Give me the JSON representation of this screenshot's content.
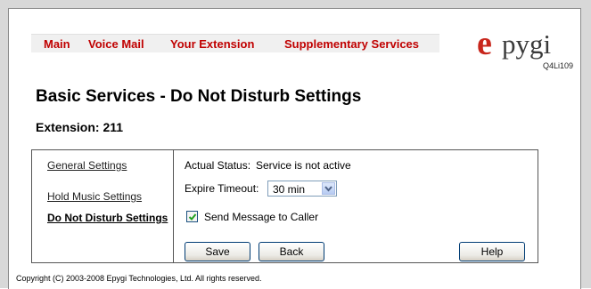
{
  "nav": {
    "items": [
      {
        "label": "Main"
      },
      {
        "label": "Voice Mail"
      },
      {
        "label": "Your Extension"
      },
      {
        "label": "Supplementary Services"
      }
    ]
  },
  "logo": {
    "brand_letter": "e",
    "brand_text": "pygi",
    "model": "Q4Li109",
    "color": "#c8261c"
  },
  "page": {
    "title": "Basic Services - Do Not Disturb Settings",
    "extension_label": "Extension: 211"
  },
  "sidebar": {
    "items": [
      {
        "label": "General Settings",
        "active": false
      },
      {
        "label": "Hold Music Settings",
        "active": false
      },
      {
        "label": "Do Not Disturb Settings",
        "active": true
      }
    ]
  },
  "form": {
    "status_label": "Actual Status:",
    "status_value": "Service is not active",
    "expire_label": "Expire Timeout:",
    "expire_value": "30 min",
    "send_message_label": "Send Message to Caller",
    "send_message_checked": true
  },
  "buttons": {
    "save": "Save",
    "back": "Back",
    "help": "Help"
  },
  "footer": {
    "copyright": "Copyright (C) 2003-2008 Epygi Technologies, Ltd. All rights reserved."
  }
}
